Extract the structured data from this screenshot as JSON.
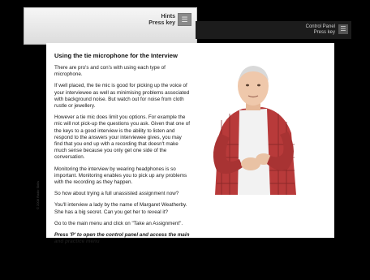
{
  "hints": {
    "title": "Hints",
    "instruction": "Press key",
    "key_symbol": "☰"
  },
  "control_panel": {
    "title": "Control Panel",
    "instruction": "Press key",
    "key_symbol": "☰"
  },
  "lesson": {
    "heading": "Using the tie microphone for the Interview",
    "paragraphs": [
      "There are pro's and con's with using each type of microphone.",
      "If well placed, the tie mic is good for picking up the voice of your interviewee as well as minimising problems associated with background noise. But watch out for noise from cloth rustle or jewellery.",
      "However a tie mic does limit you options. For example the mic will not pick-up the questions you ask. Given that one of the keys to a good interview is the ability to listen and respond to the answers your interviewee gives, you may find that you end up with a recording that doesn't  make much sense because you only get one side of the conversation.",
      "Monitoring the interview by wearing headphones is so important. Monitoring enables you to pick up any problems with the recording as they happen.",
      "So how about trying a full unassisted assignment now?",
      "You'll interview a lady by the name of Margaret Weatherby. She has a big secret. Can you get her to reveal it?",
      "Go to the main menu and click on \"Take an Assignment\"."
    ],
    "call_to_action": "Press 'P' to open the control panel and access the main and practice menu"
  },
  "side_label": "© 2008 Radio Skills",
  "presenter": {
    "icon": "presenter-video-icon"
  },
  "colors": {
    "background": "#000000",
    "panel": "#ffffff",
    "shirt": "#b83a3a"
  }
}
